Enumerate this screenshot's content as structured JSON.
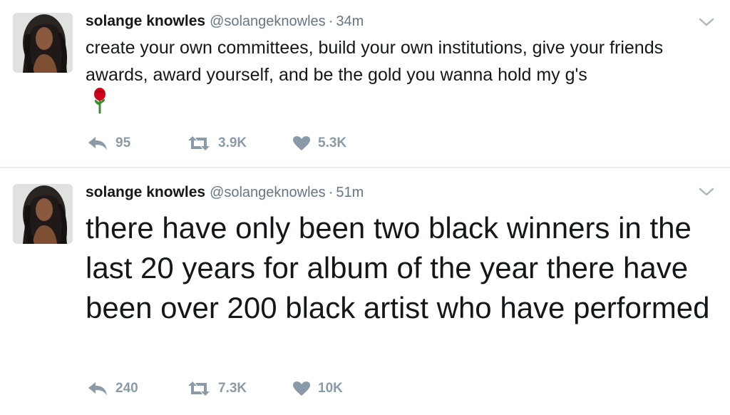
{
  "tweets": [
    {
      "name": "solange knowles",
      "handle": "@solangeknowles",
      "separator": "·",
      "time": "34m",
      "text": "create your own committees, build your own institutions, give your friends awards, award yourself, and be the gold you wanna hold my g's",
      "emoji": "rose-icon",
      "replies": "95",
      "retweets": "3.9K",
      "likes": "5.3K"
    },
    {
      "name": "solange knowles",
      "handle": "@solangeknowles",
      "separator": "·",
      "time": "51m",
      "text": "there have only been two black winners in the last 20 years for album of the year there have been over 200 black artist who have performed",
      "replies": "240",
      "retweets": "7.3K",
      "likes": "10K"
    }
  ],
  "icons": {
    "reply": "reply-icon",
    "retweet": "retweet-icon",
    "like": "heart-icon",
    "caret": "chevron-down-icon",
    "avatar": "avatar"
  },
  "colors": {
    "text": "#14171a",
    "meta": "#657786",
    "action": "#8a9aa8",
    "divider": "#e6ecf0",
    "rose": "#d0021b",
    "stem": "#3a8f2d"
  }
}
